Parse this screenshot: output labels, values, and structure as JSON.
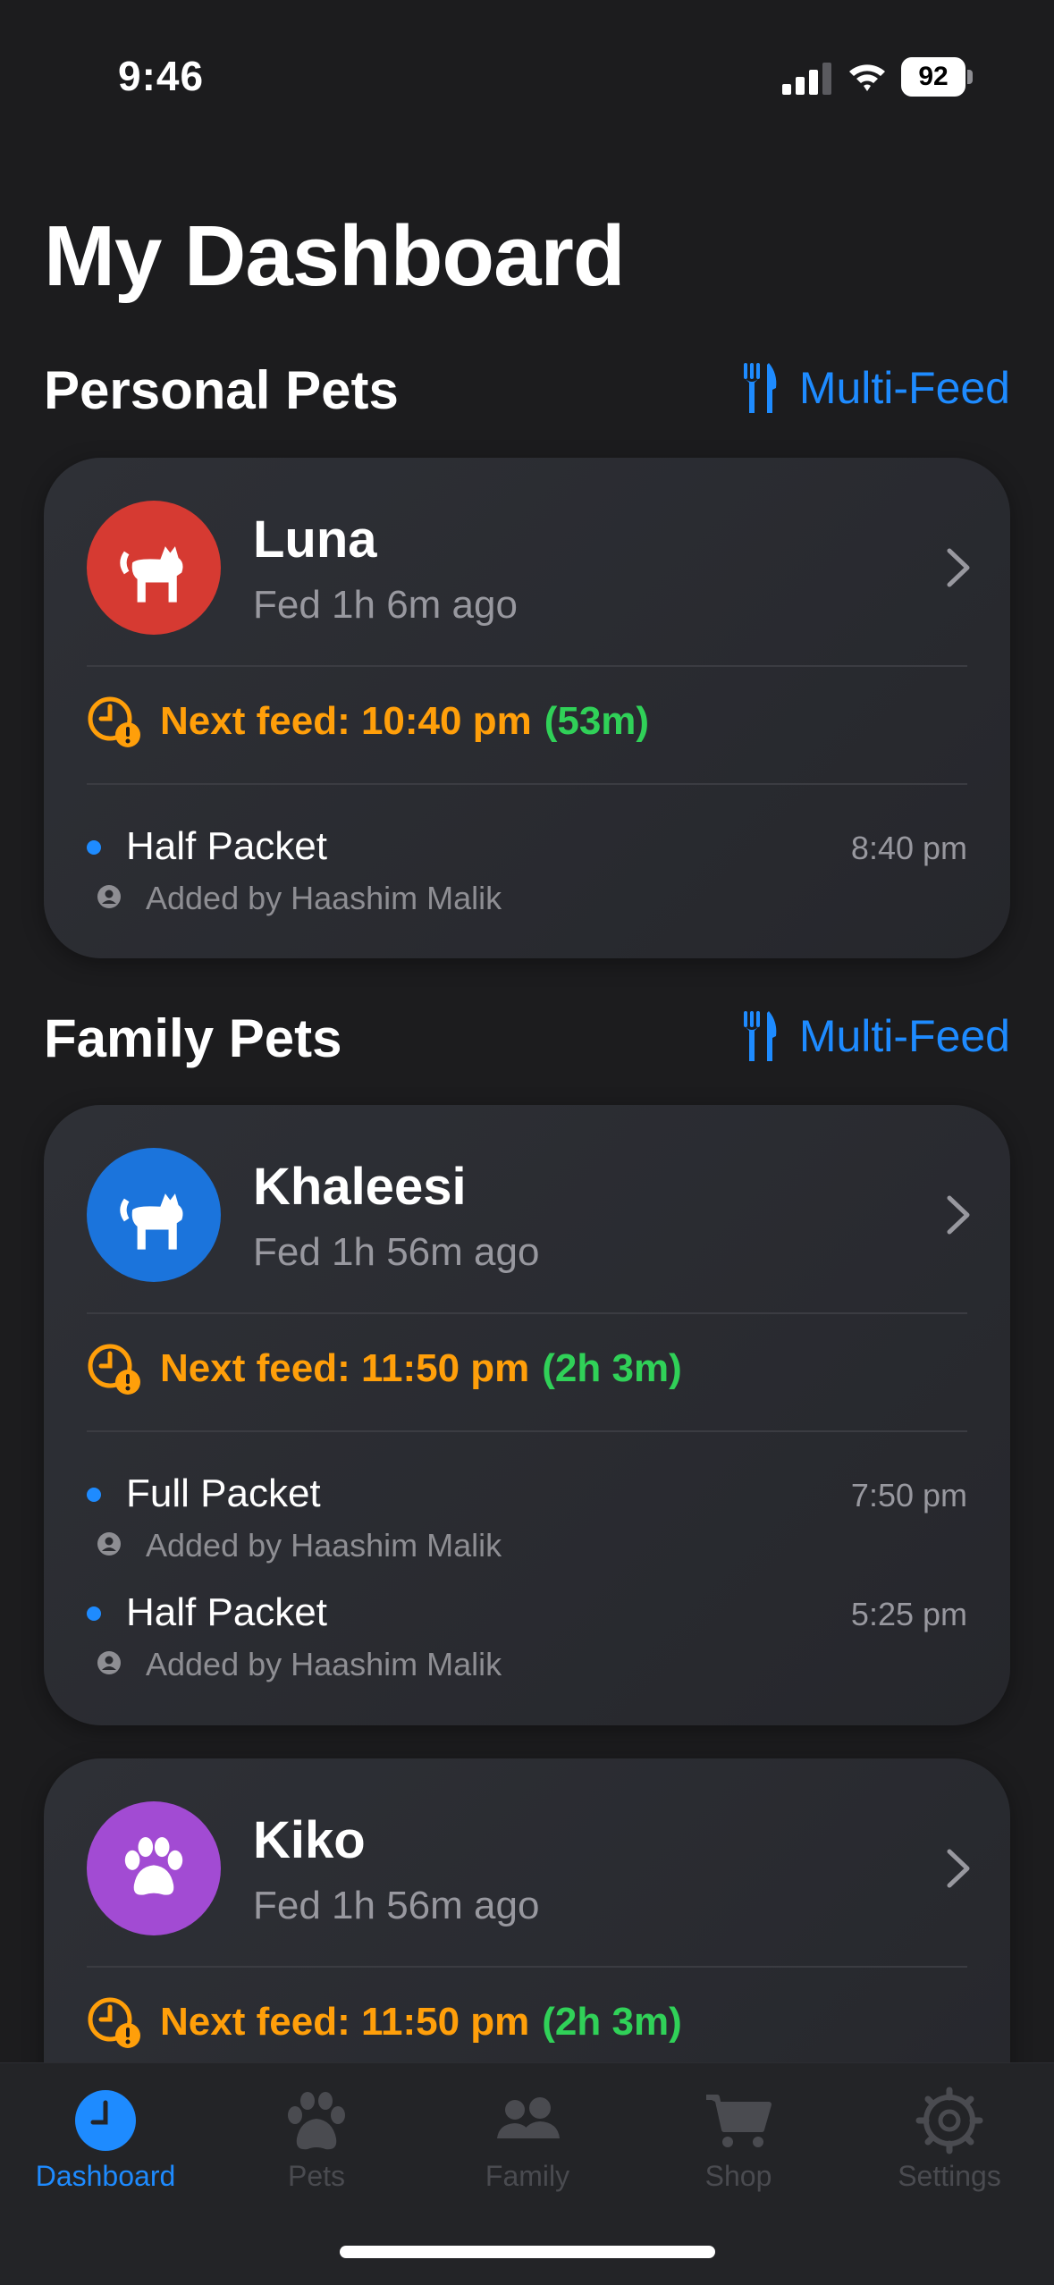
{
  "status_bar": {
    "time": "9:46",
    "battery": "92"
  },
  "title": "My Dashboard",
  "colors": {
    "accent": "#1e8bff",
    "next_feed": "#ff9f0a",
    "remaining": "#30d158",
    "luna": "#d63a32",
    "khaleesi": "#1b74dc",
    "kiko": "#a24bd3"
  },
  "sections": [
    {
      "title": "Personal Pets",
      "action": "Multi-Feed",
      "action_icon": "fork-knife-icon"
    },
    {
      "title": "Family Pets",
      "action": "Multi-Feed",
      "action_icon": "fork-knife-icon"
    }
  ],
  "pets": [
    {
      "name": "Luna",
      "icon": "cat-icon",
      "fed": "Fed 1h 6m ago",
      "next_feed": "Next feed: 10:40 pm",
      "remaining": "(53m)",
      "entries": [
        {
          "name": "Half Packet",
          "time": "8:40 pm",
          "added_by": "Added by Haashim Malik"
        }
      ]
    },
    {
      "name": "Khaleesi",
      "icon": "cat-icon",
      "fed": "Fed 1h 56m ago",
      "next_feed": "Next feed: 11:50 pm",
      "remaining": "(2h 3m)",
      "entries": [
        {
          "name": "Full Packet",
          "time": "7:50 pm",
          "added_by": "Added by Haashim Malik"
        },
        {
          "name": "Half Packet",
          "time": "5:25 pm",
          "added_by": "Added by Haashim Malik"
        }
      ]
    },
    {
      "name": "Kiko",
      "icon": "paw-icon",
      "fed": "Fed 1h 56m ago",
      "next_feed": "Next feed: 11:50 pm",
      "remaining": "(2h 3m)",
      "entries": []
    }
  ],
  "tabs": [
    {
      "label": "Dashboard",
      "icon": "clock-icon",
      "active": true
    },
    {
      "label": "Pets",
      "icon": "paw-icon",
      "active": false
    },
    {
      "label": "Family",
      "icon": "people-icon",
      "active": false
    },
    {
      "label": "Shop",
      "icon": "cart-icon",
      "active": false
    },
    {
      "label": "Settings",
      "icon": "gear-icon",
      "active": false
    }
  ]
}
